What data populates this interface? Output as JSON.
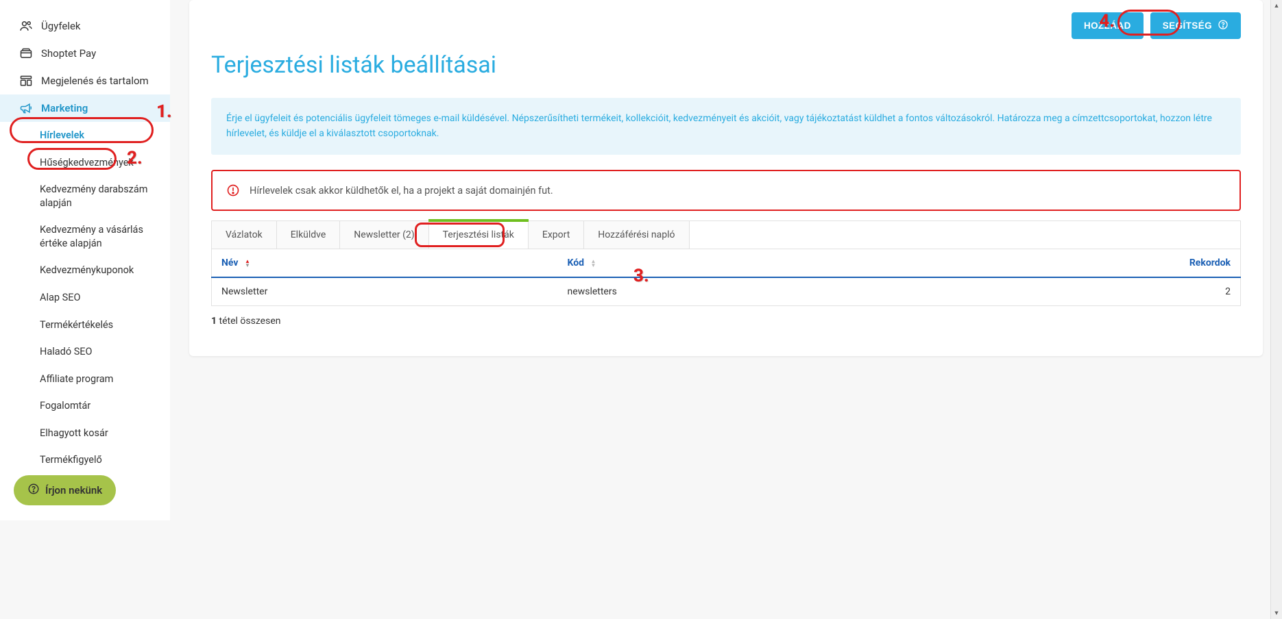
{
  "sidebar": {
    "items": [
      {
        "label": "Ügyfelek",
        "icon": "users"
      },
      {
        "label": "Shoptet Pay",
        "icon": "wallet"
      },
      {
        "label": "Megjelenés és tartalom",
        "icon": "layout"
      },
      {
        "label": "Marketing",
        "icon": "megaphone",
        "active": true
      }
    ],
    "sub_items": [
      {
        "label": "Hírlevelek",
        "active": true
      },
      {
        "label": "Hűségkedvezmények"
      },
      {
        "label": "Kedvezmény darabszám alapján"
      },
      {
        "label": "Kedvezmény a vásárlás értéke alapján"
      },
      {
        "label": "Kedvezménykuponok"
      },
      {
        "label": "Alap SEO"
      },
      {
        "label": "Termékértékelés"
      },
      {
        "label": "Haladó SEO"
      },
      {
        "label": "Affiliate program"
      },
      {
        "label": "Fogalomtár"
      },
      {
        "label": "Elhagyott kosár"
      },
      {
        "label": "Termékfigyelő"
      }
    ]
  },
  "buttons": {
    "add": "HOZZÁAD",
    "help": "SEGÍTSÉG",
    "write_us": "Írjon nekünk"
  },
  "page": {
    "title": "Terjesztési listák beállításai",
    "info": "Érje el ügyfeleit és potenciális ügyfeleit tömeges e-mail küldésével. Népszerűsítheti termékeit, kollekcióit, kedvezményeit és akcióit, vagy tájékoztatást küldhet a fontos változásokról. Határozza meg a címzettcsoportokat, hozzon létre hírlevelet, és küldje el a kiválasztott csoportoknak.",
    "warning": "Hírlevelek csak akkor küldhetők el, ha a projekt a saját domainjén fut."
  },
  "tabs": [
    {
      "label": "Vázlatok"
    },
    {
      "label": "Elküldve"
    },
    {
      "label": "Newsletter (2)"
    },
    {
      "label": "Terjesztési listák",
      "active": true
    },
    {
      "label": "Export"
    },
    {
      "label": "Hozzáférési napló"
    }
  ],
  "table": {
    "headers": {
      "name": "Név",
      "code": "Kód",
      "records": "Rekordok"
    },
    "rows": [
      {
        "name": "Newsletter",
        "code": "newsletters",
        "records": "2"
      }
    ],
    "summary_count": "1",
    "summary_rest": " tétel összesen"
  },
  "annotations": {
    "n1": "1.",
    "n2": "2.",
    "n3": "3.",
    "n4": "4."
  }
}
